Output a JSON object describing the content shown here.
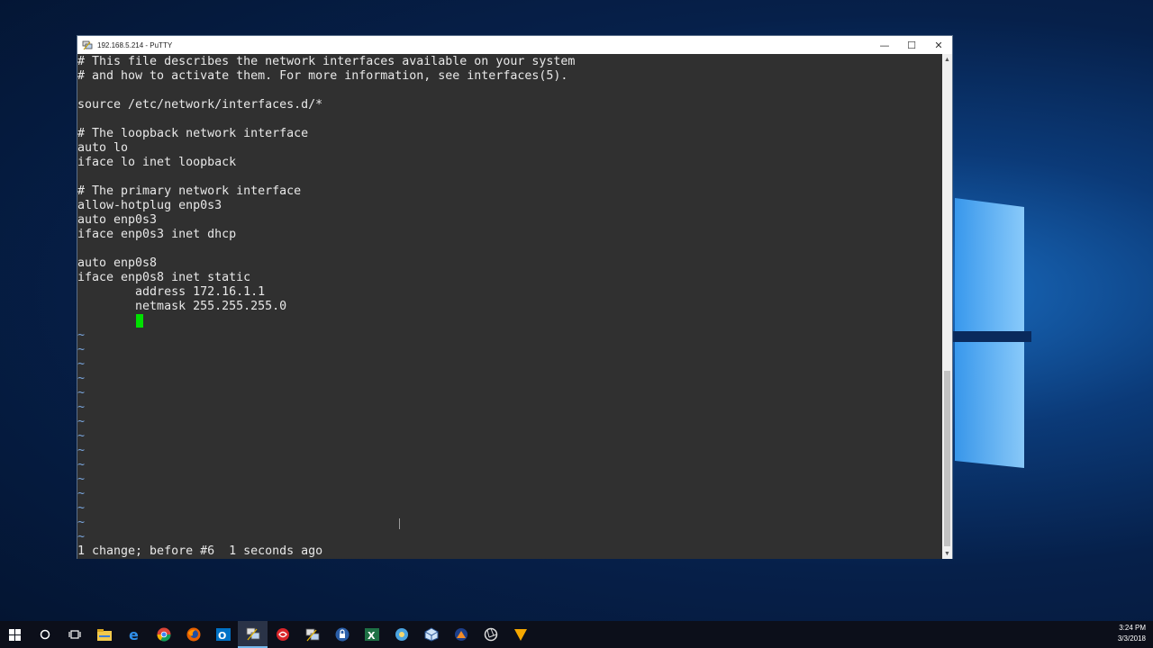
{
  "window": {
    "title": "192.168.5.214 - PuTTY",
    "controls": {
      "minimize": "—",
      "maximize": "☐",
      "close": "✕"
    }
  },
  "terminal": {
    "lines": [
      "# This file describes the network interfaces available on your system",
      "# and how to activate them. For more information, see interfaces(5).",
      "",
      "source /etc/network/interfaces.d/*",
      "",
      "# The loopback network interface",
      "auto lo",
      "iface lo inet loopback",
      "",
      "# The primary network interface",
      "allow-hotplug enp0s3",
      "auto enp0s3",
      "iface enp0s3 inet dhcp",
      "",
      "auto enp0s8",
      "iface enp0s8 inet static",
      "        address 172.16.1.1",
      "        netmask 255.255.255.0"
    ],
    "tildes": [
      "~",
      "~",
      "~",
      "~",
      "~",
      "~",
      "~",
      "~",
      "~",
      "~",
      "~",
      "~",
      "~",
      "~",
      "~"
    ],
    "status": "1 change; before #6  1 seconds ago",
    "cursor_color": "#00e000"
  },
  "taskbar": {
    "items": [
      {
        "name": "start",
        "icon": "windows-logo-icon"
      },
      {
        "name": "search",
        "icon": "cortana-circle-icon"
      },
      {
        "name": "task-view",
        "icon": "task-view-icon"
      },
      {
        "name": "file-explorer",
        "icon": "folder-icon"
      },
      {
        "name": "edge",
        "icon": "edge-icon"
      },
      {
        "name": "chrome",
        "icon": "chrome-icon"
      },
      {
        "name": "firefox",
        "icon": "firefox-icon"
      },
      {
        "name": "outlook",
        "icon": "outlook-icon"
      },
      {
        "name": "putty",
        "icon": "putty-icon",
        "active": true
      },
      {
        "name": "app-red",
        "icon": "red-circle-app-icon"
      },
      {
        "name": "putty-2",
        "icon": "putty-icon"
      },
      {
        "name": "keepass",
        "icon": "lock-icon"
      },
      {
        "name": "excel",
        "icon": "excel-icon"
      },
      {
        "name": "app-sun",
        "icon": "sun-app-icon"
      },
      {
        "name": "virtualbox",
        "icon": "virtualbox-icon"
      },
      {
        "name": "app-mountain",
        "icon": "mountain-app-icon"
      },
      {
        "name": "app-aperture",
        "icon": "aperture-icon"
      },
      {
        "name": "vlc",
        "icon": "cone-icon"
      }
    ],
    "clock": {
      "time": "3:24 PM",
      "date": "3/3/2018"
    }
  }
}
